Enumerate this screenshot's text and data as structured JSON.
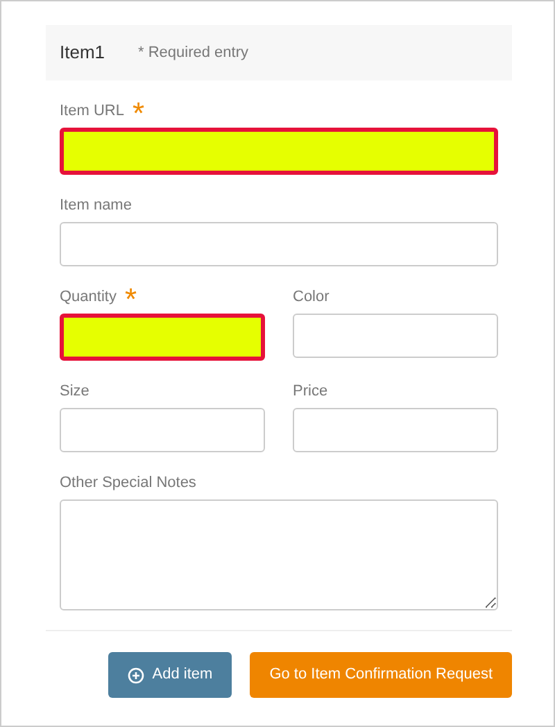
{
  "header": {
    "title": "Item1",
    "note": "* Required entry"
  },
  "rows": [
    [
      {
        "label": "Item URL",
        "required_mark": "*",
        "highlighted": true,
        "kind": "text"
      }
    ],
    [
      {
        "label": "Item name",
        "highlighted": false,
        "kind": "text"
      }
    ],
    [
      {
        "label": "Quantity",
        "required_mark": "*",
        "highlighted": true,
        "kind": "text"
      },
      {
        "label": "Color",
        "highlighted": false,
        "kind": "text"
      }
    ],
    [
      {
        "label": "Size",
        "highlighted": false,
        "kind": "text"
      },
      {
        "label": "Price",
        "highlighted": false,
        "kind": "text"
      }
    ],
    [
      {
        "label": "Other Special Notes",
        "highlighted": false,
        "kind": "textarea"
      }
    ]
  ],
  "buttons": [
    {
      "label": "Add item",
      "kind": "secondary"
    },
    {
      "label": "Go to Item Confirmation Request",
      "kind": "primary"
    }
  ]
}
